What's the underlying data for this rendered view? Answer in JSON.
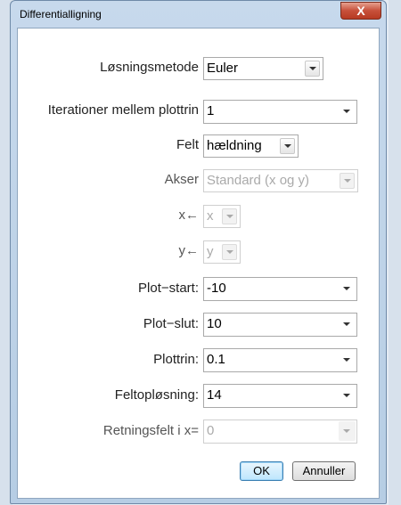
{
  "dialog": {
    "title": "Differentialligning",
    "close_glyph": "X"
  },
  "fields": {
    "method": {
      "label": "Løsningsmetode",
      "value": "Euler"
    },
    "iterations": {
      "label": "Iterationer mellem plottrin",
      "value": "1"
    },
    "field": {
      "label": "Felt",
      "value": "hældning"
    },
    "axes": {
      "label": "Akser",
      "value": "Standard (x og y)"
    },
    "x_axis": {
      "label": "x←",
      "value": "x"
    },
    "y_axis": {
      "label": "y←",
      "value": "y"
    },
    "plot_start": {
      "label": "Plot−start:",
      "value": "-10"
    },
    "plot_end": {
      "label": "Plot−slut:",
      "value": "10"
    },
    "plot_step": {
      "label": "Plottrin:",
      "value": "0.1"
    },
    "field_resolution": {
      "label": "Feltopløsning:",
      "value": "14"
    },
    "direction_field": {
      "label": "Retningsfelt i x=",
      "value": "0"
    }
  },
  "buttons": {
    "ok": "OK",
    "cancel": "Annuller"
  }
}
